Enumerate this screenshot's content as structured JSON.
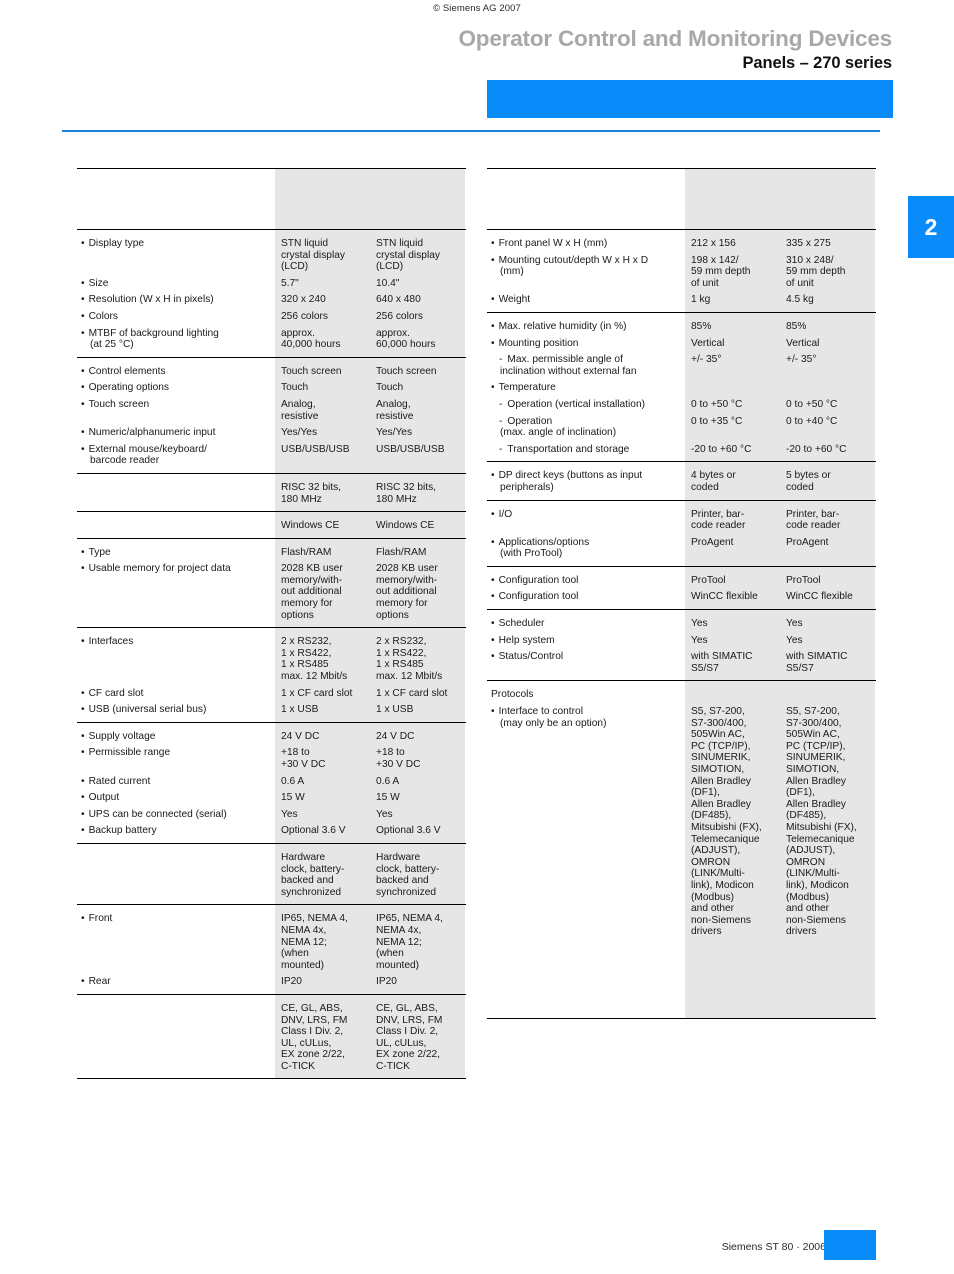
{
  "header": {
    "copyright": "© Siemens AG 2007",
    "title_main": "Operator Control and Monitoring Devices",
    "title_sub": "Panels – 270 series",
    "chapter_tab": "2",
    "accent_color": "#0a8bfa",
    "rule_color": "#1a7fd4",
    "title_main_color": "#a8a8a8"
  },
  "footer": {
    "text": "Siemens ST 80 · 2006"
  },
  "left_table": {
    "blocks": [
      {
        "rule": "top",
        "rows": [
          {
            "label": [
              ""
            ],
            "v1": [
              ""
            ],
            "v2": [
              ""
            ],
            "spacer": 46
          }
        ]
      },
      {
        "rule": "mid",
        "rows": [
          {
            "label": [
              "Display type"
            ],
            "type": "bullet",
            "v1": [
              "STN liquid",
              "crystal display",
              "(LCD)"
            ],
            "v2": [
              "STN liquid",
              "crystal display",
              "(LCD)"
            ]
          },
          {
            "label": [
              "Size"
            ],
            "type": "bullet",
            "v1": [
              "5.7\""
            ],
            "v2": [
              "10.4\""
            ]
          },
          {
            "label": [
              "Resolution (W x H in pixels)"
            ],
            "type": "bullet",
            "v1": [
              "320 x 240"
            ],
            "v2": [
              "640 x 480"
            ]
          },
          {
            "label": [
              "Colors"
            ],
            "type": "bullet",
            "v1": [
              "256 colors"
            ],
            "v2": [
              "256 colors"
            ]
          },
          {
            "label": [
              "MTBF of background lighting",
              "(at 25 °C)"
            ],
            "type": "bullet",
            "v1": [
              "approx.",
              "40,000 hours"
            ],
            "v2": [
              "approx.",
              "60,000 hours"
            ]
          }
        ]
      },
      {
        "rule": "mid",
        "rows": [
          {
            "label": [
              "Control elements"
            ],
            "type": "bullet",
            "v1": [
              "Touch screen"
            ],
            "v2": [
              "Touch screen"
            ]
          },
          {
            "label": [
              "Operating options"
            ],
            "type": "bullet",
            "v1": [
              "Touch"
            ],
            "v2": [
              "Touch"
            ]
          },
          {
            "label": [
              "Touch screen"
            ],
            "type": "bullet",
            "v1": [
              "Analog,",
              "resistive"
            ],
            "v2": [
              "Analog,",
              "resistive"
            ]
          },
          {
            "label": [
              "Numeric/alphanumeric input"
            ],
            "type": "bullet",
            "v1": [
              "Yes/Yes"
            ],
            "v2": [
              "Yes/Yes"
            ]
          },
          {
            "label": [
              "External mouse/keyboard/",
              "barcode reader"
            ],
            "type": "bullet",
            "v1": [
              "USB/USB/USB"
            ],
            "v2": [
              "USB/USB/USB"
            ]
          }
        ]
      },
      {
        "rule": "mid",
        "rows": [
          {
            "label": [
              ""
            ],
            "type": "plain",
            "v1": [
              "RISC 32 bits,",
              "180 MHz"
            ],
            "v2": [
              "RISC 32 bits,",
              "180 MHz"
            ]
          }
        ]
      },
      {
        "rule": "mid",
        "rows": [
          {
            "label": [
              ""
            ],
            "type": "plain",
            "v1": [
              "Windows CE"
            ],
            "v2": [
              "Windows CE"
            ]
          }
        ]
      },
      {
        "rule": "mid",
        "rows": [
          {
            "label": [
              "Type"
            ],
            "type": "bullet",
            "v1": [
              "Flash/RAM"
            ],
            "v2": [
              "Flash/RAM"
            ]
          },
          {
            "label": [
              "Usable memory for project data"
            ],
            "type": "bullet",
            "v1": [
              "2028 KB user",
              "memory/with-",
              "out additional",
              "memory for",
              "options"
            ],
            "v2": [
              "2028 KB user",
              "memory/with-",
              "out additional",
              "memory for",
              "options"
            ]
          }
        ]
      },
      {
        "rule": "mid",
        "rows": [
          {
            "label": [
              "Interfaces"
            ],
            "type": "bullet",
            "v1": [
              "2 x RS232,",
              "1 x RS422,",
              "1 x RS485",
              "max. 12 Mbit/s"
            ],
            "v2": [
              "2 x RS232,",
              "1 x RS422,",
              "1 x RS485",
              "max. 12 Mbit/s"
            ]
          },
          {
            "label": [
              "CF card slot"
            ],
            "type": "bullet",
            "v1": [
              "1 x CF card slot"
            ],
            "v2": [
              "1 x CF card slot"
            ]
          },
          {
            "label": [
              "USB (universal serial bus)"
            ],
            "type": "bullet",
            "v1": [
              "1 x USB"
            ],
            "v2": [
              "1 x USB"
            ]
          }
        ]
      },
      {
        "rule": "mid",
        "rows": [
          {
            "label": [
              "Supply voltage"
            ],
            "type": "bullet",
            "v1": [
              "24 V DC"
            ],
            "v2": [
              "24 V DC"
            ]
          },
          {
            "label": [
              "Permissible range"
            ],
            "type": "bullet",
            "v1": [
              "+18 to",
              "+30 V DC"
            ],
            "v2": [
              "+18 to",
              "+30 V DC"
            ]
          },
          {
            "label": [
              "Rated current"
            ],
            "type": "bullet",
            "v1": [
              "0.6 A"
            ],
            "v2": [
              "0.6 A"
            ]
          },
          {
            "label": [
              "Output"
            ],
            "type": "bullet",
            "v1": [
              "15 W"
            ],
            "v2": [
              "15 W"
            ]
          },
          {
            "label": [
              "UPS can be connected (serial)"
            ],
            "type": "bullet",
            "v1": [
              "Yes"
            ],
            "v2": [
              "Yes"
            ]
          },
          {
            "label": [
              "Backup battery"
            ],
            "type": "bullet",
            "v1": [
              "Optional 3.6 V"
            ],
            "v2": [
              "Optional 3.6 V"
            ]
          }
        ]
      },
      {
        "rule": "mid",
        "rows": [
          {
            "label": [
              ""
            ],
            "type": "plain",
            "v1": [
              "Hardware",
              "clock, battery-",
              "backed and",
              "synchronized"
            ],
            "v2": [
              "Hardware",
              "clock, battery-",
              "backed and",
              "synchronized"
            ]
          }
        ]
      },
      {
        "rule": "mid",
        "rows": [
          {
            "label": [
              "Front"
            ],
            "type": "bullet",
            "v1": [
              "IP65, NEMA 4,",
              "NEMA 4x,",
              "NEMA 12;",
              "(when",
              "mounted)"
            ],
            "v2": [
              "IP65, NEMA 4,",
              "NEMA 4x,",
              "NEMA 12;",
              "(when",
              "mounted)"
            ]
          },
          {
            "label": [
              "Rear"
            ],
            "type": "bullet",
            "v1": [
              "IP20"
            ],
            "v2": [
              "IP20"
            ]
          }
        ]
      },
      {
        "rule": "mid",
        "rows": [
          {
            "label": [
              ""
            ],
            "type": "plain",
            "v1": [
              "CE, GL, ABS,",
              "DNV, LRS, FM",
              "Class I Div. 2,",
              "UL, cULus,",
              "EX zone 2/22,",
              "C-TICK"
            ],
            "v2": [
              "CE, GL, ABS,",
              "DNV, LRS, FM",
              "Class I Div. 2,",
              "UL, cULus,",
              "EX zone 2/22,",
              "C-TICK"
            ]
          }
        ]
      }
    ]
  },
  "right_table": {
    "blocks": [
      {
        "rule": "top",
        "rows": [
          {
            "label": [
              ""
            ],
            "v1": [
              ""
            ],
            "v2": [
              ""
            ],
            "spacer": 46
          }
        ]
      },
      {
        "rule": "mid",
        "rows": [
          {
            "label": [
              "Front panel W x H (mm)"
            ],
            "type": "bullet",
            "v1": [
              "212 x 156"
            ],
            "v2": [
              "335 x 275"
            ]
          },
          {
            "label": [
              "Mounting cutout/depth W x H x D",
              "(mm)"
            ],
            "type": "bullet",
            "v1": [
              "198 x 142/",
              "59 mm depth",
              "of unit"
            ],
            "v2": [
              "310 x 248/",
              "59 mm depth",
              "of unit"
            ]
          },
          {
            "label": [
              "Weight"
            ],
            "type": "bullet",
            "v1": [
              "1 kg"
            ],
            "v2": [
              "4.5 kg"
            ]
          }
        ]
      },
      {
        "rule": "mid",
        "rows": [
          {
            "label": [
              "Max. relative humidity (in %)"
            ],
            "type": "bullet",
            "v1": [
              "85%"
            ],
            "v2": [
              "85%"
            ]
          },
          {
            "label": [
              "Mounting position"
            ],
            "type": "bullet",
            "v1": [
              "Vertical"
            ],
            "v2": [
              "Vertical"
            ]
          },
          {
            "label": [
              "Max. permissible angle of",
              "inclination without external fan"
            ],
            "type": "dash",
            "v1": [
              "+/- 35°"
            ],
            "v2": [
              "+/- 35°"
            ]
          },
          {
            "label": [
              "Temperature"
            ],
            "type": "bullet",
            "v1": [
              ""
            ],
            "v2": [
              ""
            ]
          },
          {
            "label": [
              "Operation (vertical installation)"
            ],
            "type": "dash",
            "v1": [
              "0 to +50 °C"
            ],
            "v2": [
              "0 to +50 °C"
            ]
          },
          {
            "label": [
              "Operation",
              "(max. angle of inclination)"
            ],
            "type": "dash",
            "v1": [
              "0 to +35 °C"
            ],
            "v2": [
              "0 to +40 °C"
            ]
          },
          {
            "label": [
              "Transportation and storage"
            ],
            "type": "dash",
            "v1": [
              "-20 to +60 °C"
            ],
            "v2": [
              "-20 to +60 °C"
            ]
          }
        ]
      },
      {
        "rule": "mid",
        "rows": [
          {
            "label": [
              "DP direct keys (buttons as input",
              "peripherals)"
            ],
            "type": "bullet",
            "v1": [
              "4 bytes or",
              "coded"
            ],
            "v2": [
              "5 bytes or",
              "coded"
            ]
          }
        ]
      },
      {
        "rule": "mid",
        "rows": [
          {
            "label": [
              "I/O"
            ],
            "type": "bullet",
            "v1": [
              "Printer, bar-",
              "code reader"
            ],
            "v2": [
              "Printer, bar-",
              "code reader"
            ]
          },
          {
            "label": [
              "Applications/options",
              "(with ProTool)"
            ],
            "type": "bullet",
            "v1": [
              "ProAgent"
            ],
            "v2": [
              "ProAgent"
            ]
          }
        ]
      },
      {
        "rule": "mid",
        "rows": [
          {
            "label": [
              "Configuration tool"
            ],
            "type": "bullet",
            "v1": [
              "ProTool"
            ],
            "v2": [
              "ProTool"
            ]
          },
          {
            "label": [
              "Configuration tool"
            ],
            "type": "bullet",
            "v1": [
              "WinCC flexible"
            ],
            "v2": [
              "WinCC flexible"
            ]
          }
        ]
      },
      {
        "rule": "mid",
        "rows": [
          {
            "label": [
              "Scheduler"
            ],
            "type": "bullet",
            "v1": [
              "Yes"
            ],
            "v2": [
              "Yes"
            ]
          },
          {
            "label": [
              "Help system"
            ],
            "type": "bullet",
            "v1": [
              "Yes"
            ],
            "v2": [
              "Yes"
            ]
          },
          {
            "label": [
              "Status/Control"
            ],
            "type": "bullet",
            "v1": [
              "with SIMATIC",
              "S5/S7"
            ],
            "v2": [
              "with SIMATIC",
              "S5/S7"
            ]
          }
        ]
      },
      {
        "rule": "mid",
        "rows": [
          {
            "label": [
              "Protocols"
            ],
            "type": "plain",
            "v1": [
              ""
            ],
            "v2": [
              ""
            ]
          },
          {
            "label": [
              "Interface to control",
              "(may only be an option)"
            ],
            "type": "bullet",
            "v1": [
              "S5, S7-200,",
              "S7-300/400,",
              "505Win AC,",
              "PC (TCP/IP),",
              "SINUMERIK,",
              "SIMOTION,",
              "Allen Bradley",
              "(DF1),",
              "Allen Bradley",
              "(DF485),",
              "Mitsubishi (FX),",
              "Telemecanique",
              "(ADJUST),",
              "OMRON",
              "(LINK/Multi-",
              "link), Modicon",
              "(Modbus)",
              "and other",
              "non-Siemens",
              "drivers"
            ],
            "v2": [
              "S5, S7-200,",
              "S7-300/400,",
              "505Win AC,",
              "PC (TCP/IP),",
              "SINUMERIK,",
              "SIMOTION,",
              "Allen Bradley",
              "(DF1),",
              "Allen Bradley",
              "(DF485),",
              "Mitsubishi (FX),",
              "Telemecanique",
              "(ADJUST),",
              "OMRON",
              "(LINK/Multi-",
              "link), Modicon",
              "(Modbus)",
              "and other",
              "non-Siemens",
              "drivers"
            ]
          }
        ]
      },
      {
        "rule": "bottom-pad",
        "rows": [
          {
            "label": [
              ""
            ],
            "v1": [
              ""
            ],
            "v2": [
              ""
            ],
            "spacer": 60
          }
        ]
      }
    ]
  }
}
